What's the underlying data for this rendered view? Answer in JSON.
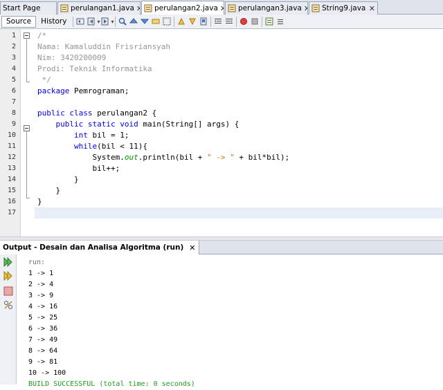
{
  "tabs": [
    {
      "label": "Start Page",
      "closable": false,
      "active": false
    },
    {
      "label": "perulangan1.java",
      "closable": true,
      "active": false
    },
    {
      "label": "perulangan2.java",
      "closable": true,
      "active": true
    },
    {
      "label": "perulangan3.java",
      "closable": true,
      "active": false
    },
    {
      "label": "String9.java",
      "closable": true,
      "active": false
    }
  ],
  "close_glyph": "✕",
  "toolbar": {
    "source_label": "Source",
    "history_label": "History"
  },
  "editor": {
    "current_line": 17,
    "lines": [
      {
        "n": "1",
        "segments": [
          {
            "t": "/*",
            "c": "cmt"
          }
        ]
      },
      {
        "n": "2",
        "segments": [
          {
            "t": "Nama: Kamaluddin Frisriansyah",
            "c": "cmt"
          }
        ]
      },
      {
        "n": "3",
        "segments": [
          {
            "t": "Nim: 3420200009",
            "c": "cmt"
          }
        ]
      },
      {
        "n": "4",
        "segments": [
          {
            "t": "Prodi: Teknik Informatika",
            "c": "cmt"
          }
        ]
      },
      {
        "n": "5",
        "segments": [
          {
            "t": " */",
            "c": "cmt"
          }
        ]
      },
      {
        "n": "6",
        "segments": [
          {
            "t": "package",
            "c": "kw"
          },
          {
            "t": " Pemrograman;",
            "c": ""
          }
        ]
      },
      {
        "n": "7",
        "segments": []
      },
      {
        "n": "8",
        "segments": [
          {
            "t": "public class",
            "c": "kw"
          },
          {
            "t": " perulangan2 {",
            "c": ""
          }
        ]
      },
      {
        "n": "9",
        "segments": [
          {
            "t": "    ",
            "c": ""
          },
          {
            "t": "public static void",
            "c": "kw"
          },
          {
            "t": " main(String[] args) {",
            "c": ""
          }
        ]
      },
      {
        "n": "10",
        "segments": [
          {
            "t": "        ",
            "c": ""
          },
          {
            "t": "int",
            "c": "kw"
          },
          {
            "t": " bil = 1;",
            "c": ""
          }
        ]
      },
      {
        "n": "11",
        "segments": [
          {
            "t": "        ",
            "c": ""
          },
          {
            "t": "while",
            "c": "kw"
          },
          {
            "t": "(bil < 11){",
            "c": ""
          }
        ]
      },
      {
        "n": "12",
        "segments": [
          {
            "t": "            System.",
            "c": ""
          },
          {
            "t": "out",
            "c": "fld"
          },
          {
            "t": ".println(bil + ",
            "c": ""
          },
          {
            "t": "\" -> \"",
            "c": "str"
          },
          {
            "t": " + bil*bil);",
            "c": ""
          }
        ]
      },
      {
        "n": "13",
        "segments": [
          {
            "t": "            bil++;",
            "c": ""
          }
        ]
      },
      {
        "n": "14",
        "segments": [
          {
            "t": "        }",
            "c": ""
          }
        ]
      },
      {
        "n": "15",
        "segments": [
          {
            "t": "    }",
            "c": ""
          }
        ]
      },
      {
        "n": "16",
        "segments": [
          {
            "t": "}",
            "c": ""
          }
        ]
      },
      {
        "n": "17",
        "segments": []
      }
    ]
  },
  "output": {
    "tab_label": "Output - Desain dan Analisa Algoritma (run)",
    "lines": [
      {
        "t": "run:",
        "c": "ogray"
      },
      {
        "t": "1 -> 1",
        "c": ""
      },
      {
        "t": "2 -> 4",
        "c": ""
      },
      {
        "t": "3 -> 9",
        "c": ""
      },
      {
        "t": "4 -> 16",
        "c": ""
      },
      {
        "t": "5 -> 25",
        "c": ""
      },
      {
        "t": "6 -> 36",
        "c": ""
      },
      {
        "t": "7 -> 49",
        "c": ""
      },
      {
        "t": "8 -> 64",
        "c": ""
      },
      {
        "t": "9 -> 81",
        "c": ""
      },
      {
        "t": "10 -> 100",
        "c": ""
      },
      {
        "t": "BUILD SUCCESSFUL (total time: 0 seconds)",
        "c": "ogreen"
      }
    ]
  },
  "colors": {
    "keyword": "#0000e6",
    "comment": "#969696",
    "string": "#ce7b00",
    "field": "#009900",
    "build_success": "#1e9b1e",
    "current_line_bg": "#e9eff8"
  }
}
